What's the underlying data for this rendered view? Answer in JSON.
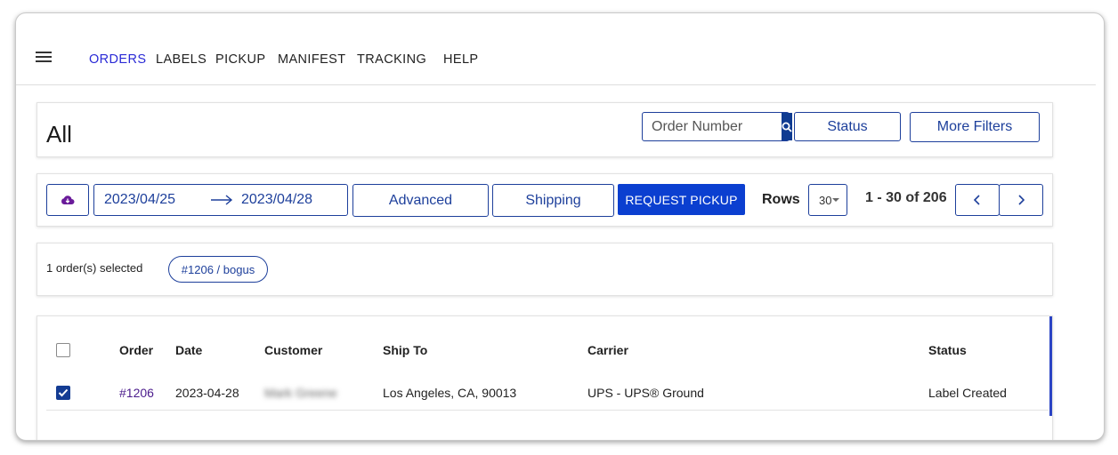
{
  "nav": {
    "items": [
      "ORDERS",
      "LABELS",
      "PICKUP",
      "MANIFEST",
      "TRACKING",
      "HELP"
    ],
    "active": "ORDERS"
  },
  "header": {
    "title": "All",
    "search_placeholder": "Order Number",
    "status_label": "Status",
    "more_filters_label": "More Filters"
  },
  "toolbar": {
    "date_from": "2023/04/25",
    "date_to": "2023/04/28",
    "advanced_label": "Advanced",
    "shipping_label": "Shipping",
    "request_pickup_label": "REQUEST PICKUP",
    "rows_label": "Rows",
    "rows_value": "30",
    "page_info": "1 - 30 of 206"
  },
  "selection": {
    "text": "1 order(s) selected",
    "chip": "#1206 / bogus"
  },
  "table": {
    "columns": [
      "Order",
      "Date",
      "Customer",
      "Ship To",
      "Carrier",
      "Status"
    ],
    "rows": [
      {
        "checked": true,
        "order": "#1206",
        "date": "2023-04-28",
        "customer": "Mark Greene",
        "ship_to": "Los Angeles, CA, 90013",
        "carrier": "UPS - UPS® Ground",
        "status": "Label Created"
      }
    ]
  },
  "colors": {
    "accent": "#1d3f9b",
    "primary_button": "#0b3fd0",
    "active_nav": "#2a2ad6",
    "order_link": "#4b1c8c"
  },
  "icons": [
    "menu-icon",
    "search-icon",
    "cloud-download-icon",
    "arrow-right-icon",
    "chevron-left-icon",
    "chevron-right-icon",
    "checkmark-icon"
  ]
}
